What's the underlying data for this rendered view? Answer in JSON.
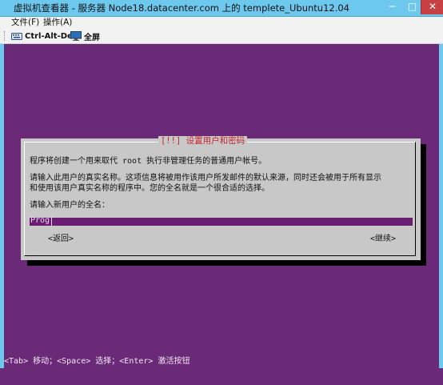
{
  "window": {
    "title": "虚拟机查看器 - 服务器 Node18.datacenter.com 上的 templete_Ubuntu12.04",
    "minimize_glyph": "─",
    "maximize_glyph": "□",
    "close_glyph": "✕"
  },
  "menubar": {
    "items": [
      "文件(F)",
      "操作(A)"
    ]
  },
  "toolbar": {
    "ctrl_alt_del_label": "Ctrl-Alt-Del",
    "fullscreen_label": "全屏"
  },
  "installer": {
    "dialog_title": "[!!] 设置用户和密码",
    "description": "程序将创建一个用来取代 root 执行非管理任务的普通用户帐号。",
    "info_line1": "请输入此用户的真实名称。这项信息将被用作该用户所发邮件的默认来源，同时还会被用于所有显示",
    "info_line2": "和使用该用户真实名称的程序中。您的全名就是一个很合适的选择。",
    "prompt": "请输入新用户的全名：",
    "input_value": "Prog",
    "back_label": "<返回>",
    "continue_label": "<继续>",
    "status_hint": "<Tab> 移动；<Space> 选择；<Enter> 激活按钮"
  },
  "colors": {
    "console_bg": "#6b2a78",
    "dialog_bg": "#c8c8c8",
    "dialog_title": "#c8262a",
    "input_bg": "#6b1d72",
    "titlebar": "#6dc8ee"
  }
}
